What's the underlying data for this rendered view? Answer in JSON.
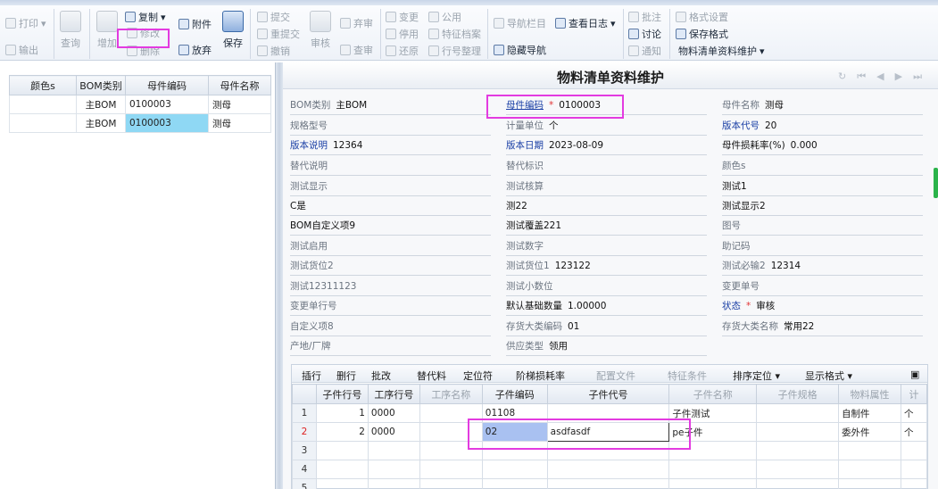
{
  "toolbar": {
    "print": "打印",
    "export": "输出",
    "query": "查询",
    "add": "增加",
    "copy": "复制",
    "modify": "修改",
    "delete": "删除",
    "attach": "附件",
    "discard": "放弃",
    "save": "保存",
    "submit": "提交",
    "resubmit": "重提交",
    "revoke": "撤销",
    "audit": "审核",
    "abandon": "弃审",
    "view_audit": "查审",
    "change": "变更",
    "disable": "停用",
    "restore": "还原",
    "common": "公用",
    "feature_file": "特征档案",
    "row_arrange": "行号整理",
    "nav_bar": "导航栏目",
    "view_log": "查看日志",
    "hide_nav": "隐藏导航",
    "comment": "批注",
    "discuss": "讨论",
    "notify": "通知",
    "format_settings": "格式设置",
    "save_format": "保存格式",
    "bom_format": "物料清单资料维护"
  },
  "left_grid": {
    "headers": [
      "颜色s",
      "BOM类别",
      "母件编码",
      "母件名称"
    ],
    "rows": [
      [
        "",
        "主BOM",
        "0100003",
        "测母"
      ],
      [
        "",
        "主BOM",
        "0100003",
        "测母"
      ]
    ]
  },
  "form": {
    "title": "物料清单资料维护",
    "nav": [
      "↻",
      "⏮",
      "◀",
      "▶",
      "⏭"
    ],
    "fields": [
      {
        "label": "BOM类别",
        "value": "主BOM"
      },
      {
        "label": "母件编码",
        "value": "0100003"
      },
      {
        "label": "母件名称",
        "value": "测母"
      },
      {
        "label": "规格型号",
        "value": ""
      },
      {
        "label": "计量单位",
        "value": "个"
      },
      {
        "label": "版本代号",
        "value": "20"
      },
      {
        "label": "版本说明",
        "value": "12364"
      },
      {
        "label": "版本日期",
        "value": "2023-08-09"
      },
      {
        "label": "母件损耗率(%)",
        "value": "0.000"
      },
      {
        "label": "替代说明",
        "value": ""
      },
      {
        "label": "替代标识",
        "value": ""
      },
      {
        "label": "颜色s",
        "value": ""
      },
      {
        "label": "测试显示",
        "value": ""
      },
      {
        "label": "测试核算",
        "value": ""
      },
      {
        "label": "测试1",
        "value": ""
      },
      {
        "label": "C是",
        "value": ""
      },
      {
        "label": "测22",
        "value": ""
      },
      {
        "label": "测试显示2",
        "value": ""
      },
      {
        "label": "BOM自定义项9",
        "value": ""
      },
      {
        "label": "测试覆盖221",
        "value": ""
      },
      {
        "label": "图号",
        "value": ""
      },
      {
        "label": "测试启用",
        "value": ""
      },
      {
        "label": "测试数字",
        "value": ""
      },
      {
        "label": "助记码",
        "value": ""
      },
      {
        "label": "测试货位2",
        "value": ""
      },
      {
        "label": "测试货位1",
        "value": "123122"
      },
      {
        "label": "测试必输2",
        "value": "12314"
      },
      {
        "label": "测试12311123",
        "value": ""
      },
      {
        "label": "测试小数位",
        "value": ""
      },
      {
        "label": "变更单号",
        "value": ""
      },
      {
        "label": "变更单行号",
        "value": ""
      },
      {
        "label": "默认基础数量",
        "value": "1.00000"
      },
      {
        "label": "状态",
        "value": "审核"
      },
      {
        "label": "自定义项8",
        "value": ""
      },
      {
        "label": "存货大类编码",
        "value": "01"
      },
      {
        "label": "存货大类名称",
        "value": "常用22"
      },
      {
        "label": "产地/厂牌",
        "value": ""
      },
      {
        "label": "供应类型",
        "value": "领用"
      }
    ],
    "required_mark": "*"
  },
  "detail": {
    "toolbar": [
      "插行",
      "删行",
      "批改",
      "替代料",
      "定位符",
      "阶梯损耗率",
      "配置文件",
      "特征条件",
      "排序定位 ▾",
      "显示格式 ▾"
    ],
    "headers": [
      "",
      "子件行号",
      "工序行号",
      "工序名称",
      "子件编码",
      "子件代号",
      "子件名称",
      "子件规格",
      "物料属性",
      "计"
    ],
    "rows": [
      [
        "1",
        "1",
        "0000",
        "",
        "01108",
        "",
        "子件测试",
        "",
        "自制件",
        "个"
      ],
      [
        "2",
        "2",
        "0000",
        "",
        "02",
        "asdfasdf",
        "pe子件",
        "",
        "委外件",
        "个"
      ],
      [
        "3",
        "",
        "",
        "",
        "",
        "",
        "",
        "",
        "",
        ""
      ],
      [
        "4",
        "",
        "",
        "",
        "",
        "",
        "",
        "",
        "",
        ""
      ],
      [
        "5",
        "",
        "",
        "",
        "",
        "",
        "",
        "",
        "",
        ""
      ]
    ]
  },
  "colors": {
    "highlight": "#e33be0",
    "selected_row": "#8fd8f4",
    "link": "#1a3fa5",
    "required": "#e23535"
  }
}
